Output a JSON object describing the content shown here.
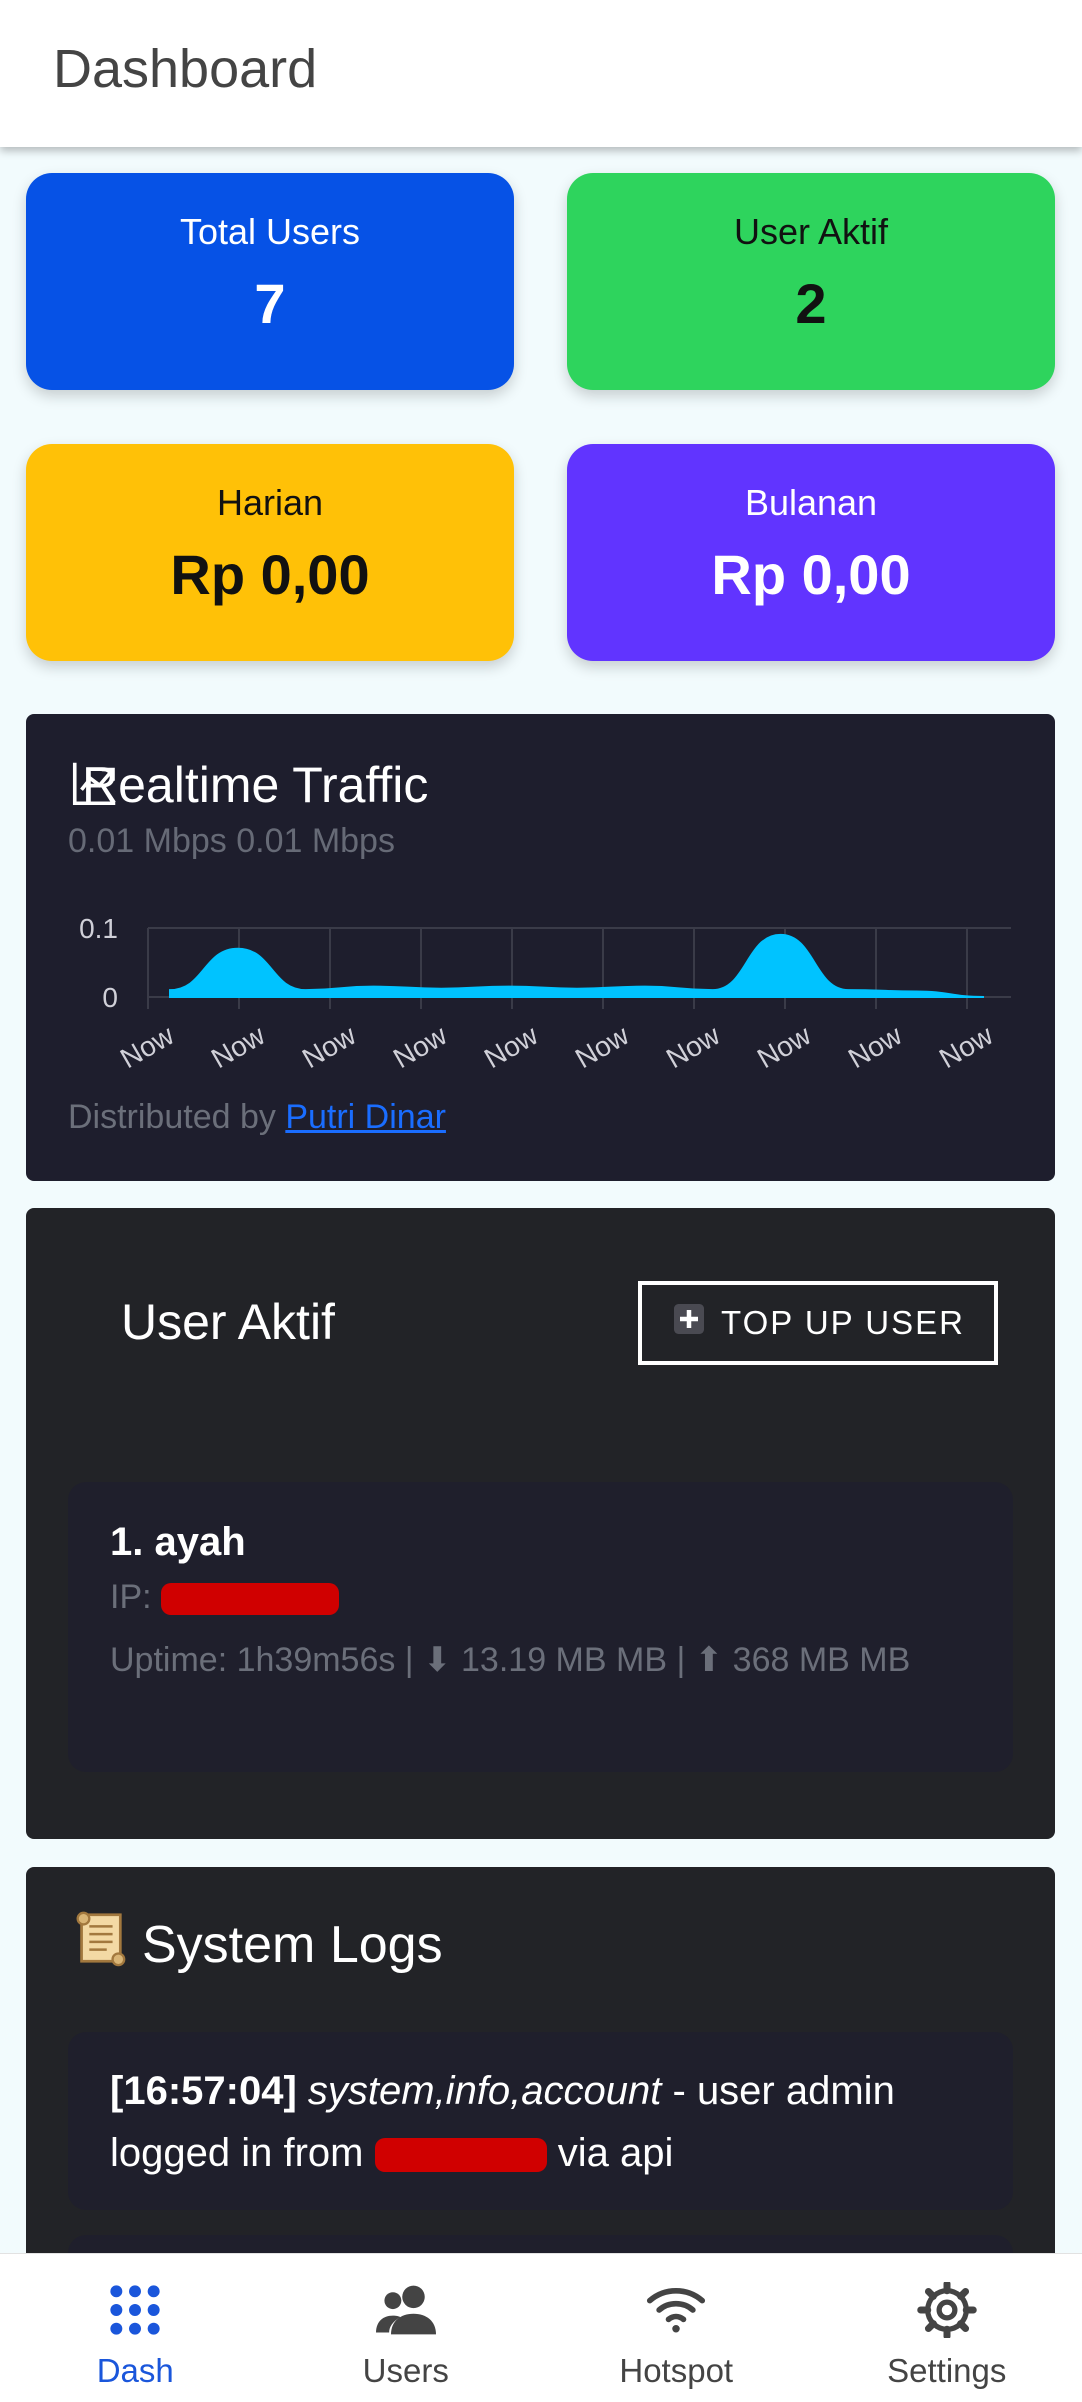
{
  "appbar": {
    "title": "Dashboard"
  },
  "stats": {
    "total_users": {
      "label": "Total Users",
      "value": "7",
      "color": "#0652e6"
    },
    "user_aktif": {
      "label": "User Aktif",
      "value": "2",
      "color": "#2ed45d"
    },
    "harian": {
      "label": "Harian",
      "value": "Rp 0,00",
      "color": "#ffc107"
    },
    "bulanan": {
      "label": "Bulanan",
      "value": "Rp 0,00",
      "color": "#6134ff"
    }
  },
  "traffic": {
    "title": "Realtime Traffic",
    "icon": "trending-up-icon",
    "speed": "0.01 Mbps 0.01 Mbps",
    "credit_prefix": "Distributed by ",
    "credit_link": "Putri Dinar"
  },
  "chart_data": {
    "type": "area",
    "categories": [
      "Now",
      "Now",
      "Now",
      "Now",
      "Now",
      "Now",
      "Now",
      "Now",
      "Now",
      "Now"
    ],
    "series": [
      {
        "values": [
          0.01,
          0.07,
          0.01,
          0.015,
          0.012,
          0.015,
          0.012,
          0.015,
          0.01,
          0.09,
          0.01,
          0.008,
          0.0
        ]
      }
    ],
    "ylim": [
      0,
      0.1
    ],
    "yticks": [
      "0.1",
      "0"
    ],
    "grid": true,
    "color": "#00c3ff"
  },
  "user_panel": {
    "title": "User Aktif",
    "topup_label": "TOP UP USER",
    "topup_icon": "plus-icon",
    "users": [
      {
        "name": "1. ayah",
        "ip_label": "IP: ",
        "uptime": "Uptime: 1h39m56s | ⬇ 13.19 MB MB | ⬆ 368 MB MB"
      }
    ]
  },
  "logs": {
    "title": "System Logs",
    "icon": "scroll-icon",
    "entries": [
      {
        "time": "[16:57:04]",
        "topic": "system,info,account",
        "msg_before": " - user admin logged in from ",
        "msg_after": " via api"
      }
    ]
  },
  "nav": {
    "items": [
      {
        "label": "Dash",
        "icon": "grid-dots-icon"
      },
      {
        "label": "Users",
        "icon": "users-icon"
      },
      {
        "label": "Hotspot",
        "icon": "wifi-icon"
      },
      {
        "label": "Settings",
        "icon": "gear-icon"
      }
    ],
    "active_color": "#1a56db"
  }
}
